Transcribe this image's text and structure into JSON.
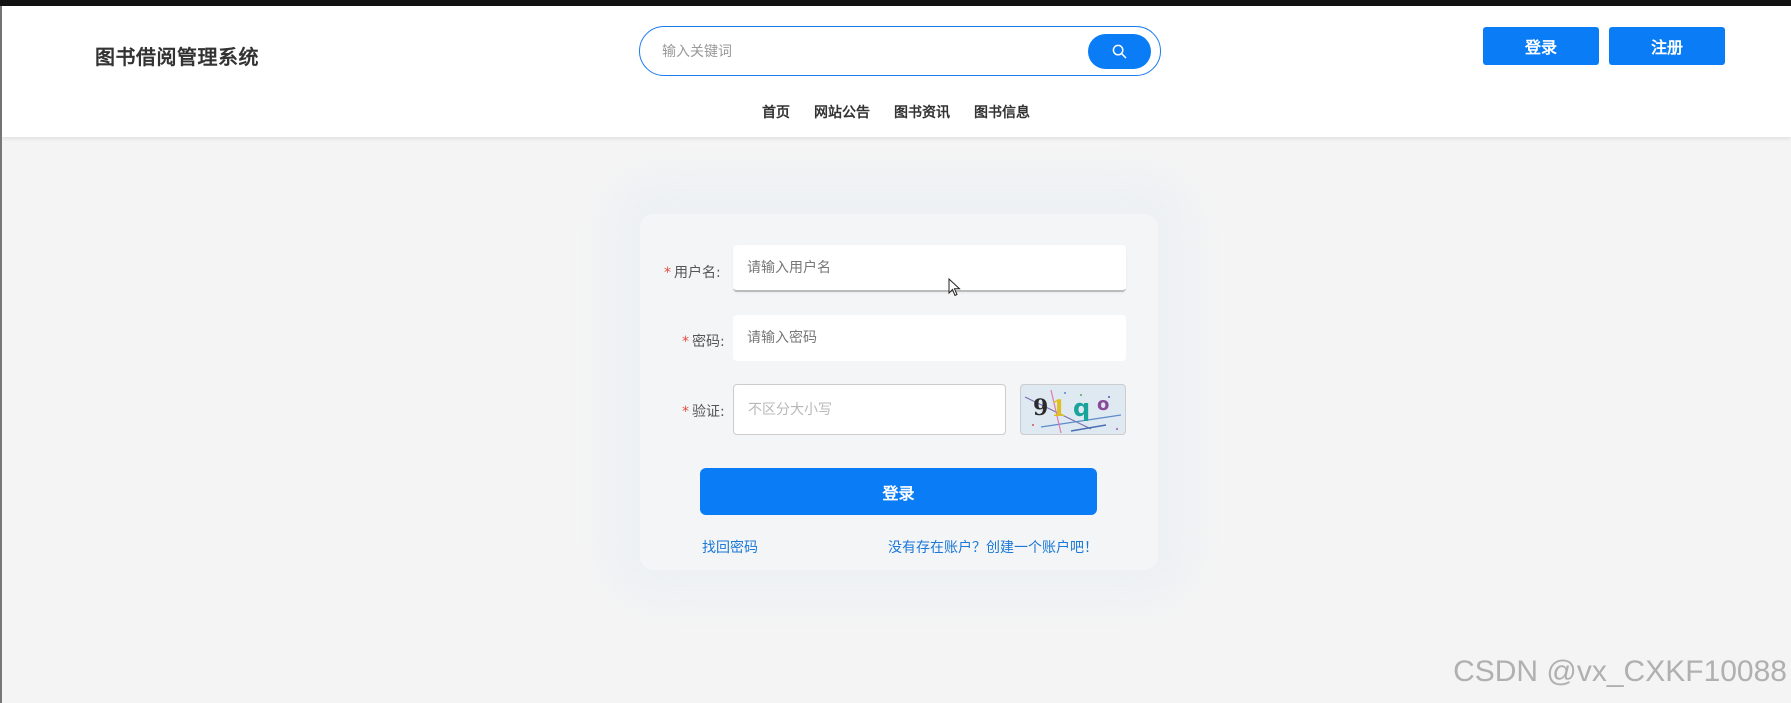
{
  "header": {
    "title": "图书借阅管理系统",
    "search_placeholder": "输入关键词",
    "login_label": "登录",
    "register_label": "注册",
    "nav": [
      "首页",
      "网站公告",
      "图书资讯",
      "图书信息"
    ]
  },
  "login_form": {
    "username_label": "用户名:",
    "username_placeholder": "请输入用户名",
    "password_label": "密码:",
    "password_placeholder": "请输入密码",
    "captcha_label": "验证:",
    "captcha_placeholder": "不区分大小写",
    "captcha_text": "91qo",
    "submit_label": "登录",
    "forgot_link": "找回密码",
    "register_link": "没有存在账户？创建一个账户吧！"
  },
  "watermark": "CSDN @vx_CXKF10088",
  "colors": {
    "primary": "#0a7cf5",
    "link": "#1a78d6",
    "required": "#e74c3c"
  }
}
